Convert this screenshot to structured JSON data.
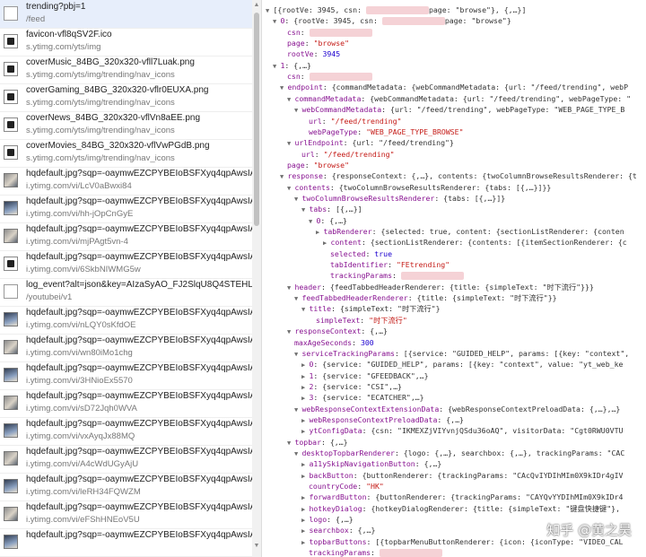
{
  "requests": [
    {
      "name": "trending?pbj=1",
      "path": "/feed",
      "icon": "doc",
      "selected": true
    },
    {
      "name": "favicon-vfl8qSV2F.ico",
      "path": "s.ytimg.com/yts/img",
      "icon": "img"
    },
    {
      "name": "coverMusic_84BG_320x320-vfll7Luak.png",
      "path": "s.ytimg.com/yts/img/trending/nav_icons",
      "icon": "img"
    },
    {
      "name": "coverGaming_84BG_320x320-vflr0EUXA.png",
      "path": "s.ytimg.com/yts/img/trending/nav_icons",
      "icon": "img"
    },
    {
      "name": "coverNews_84BG_320x320-vflVn8aEE.png",
      "path": "s.ytimg.com/yts/img/trending/nav_icons",
      "icon": "img"
    },
    {
      "name": "coverMovies_84BG_320x320-vflVwPGdB.png",
      "path": "s.ytimg.com/yts/img/trending/nav_icons",
      "icon": "img"
    },
    {
      "name": "hqdefault.jpg?sqp=-oaymwEZCPYBEIoBSFXyq4qpAwsIARUAAI",
      "path": "i.ytimg.com/vi/LcV0aBwxi84",
      "icon": "photo"
    },
    {
      "name": "hqdefault.jpg?sqp=-oaymwEZCPYBEIoBSFXyq4qpAwsIARUAAI",
      "path": "i.ytimg.com/vi/hh-jOpCnGyE",
      "icon": "photo2"
    },
    {
      "name": "hqdefault.jpg?sqp=-oaymwEZCPYBEIoBSFXyq4qpAwsIARUAAI",
      "path": "i.ytimg.com/vi/mjPAgt5vn-4",
      "icon": "photo"
    },
    {
      "name": "hqdefault.jpg?sqp=-oaymwEZCPYBEIoBSFXyq4qpAwsIARUAAI",
      "path": "i.ytimg.com/vi/6SkbNIWMG5w",
      "icon": "img"
    },
    {
      "name": "log_event?alt=json&key=AIzaSyAO_FJ2SlqU8Q4STEHLGCilw_Y",
      "path": "/youtubei/v1",
      "icon": "doc"
    },
    {
      "name": "hqdefault.jpg?sqp=-oaymwEZCPYBEIoBSFXyq4qpAwsIARUAAI",
      "path": "i.ytimg.com/vi/nLQY0sKfdOE",
      "icon": "photo2"
    },
    {
      "name": "hqdefault.jpg?sqp=-oaymwEZCPYBEIoBSFXyq4qpAwsIARUAAI",
      "path": "i.ytimg.com/vi/wn80iMo1chg",
      "icon": "photo"
    },
    {
      "name": "hqdefault.jpg?sqp=-oaymwEZCPYBEIoBSFXyq4qpAwsIARUAAI",
      "path": "i.ytimg.com/vi/3HNioEx5570",
      "icon": "photo2"
    },
    {
      "name": "hqdefault.jpg?sqp=-oaymwEZCPYBEIoBSFXyq4qpAwsIARUAAI",
      "path": "i.ytimg.com/vi/sD72Jqh0WVA",
      "icon": "photo"
    },
    {
      "name": "hqdefault.jpg?sqp=-oaymwEZCPYBEIoBSFXyq4qpAwsIARUAAI",
      "path": "i.ytimg.com/vi/vxAyqJx88MQ",
      "icon": "photo2"
    },
    {
      "name": "hqdefault.jpg?sqp=-oaymwEZCPYBEIoBSFXyq4qpAwsIARUAAI",
      "path": "i.ytimg.com/vi/A4cWdUGyAjU",
      "icon": "photo"
    },
    {
      "name": "hqdefault.jpg?sqp=-oaymwEZCPYBEIoBSFXyq4qpAwsIARUAAI",
      "path": "i.ytimg.com/vi/leRH34FQWZM",
      "icon": "photo2"
    },
    {
      "name": "hqdefault.jpg?sqp=-oaymwEZCPYBEIoBSFXyq4qpAwsIARUAAI",
      "path": "i.ytimg.com/vi/eFShHNEoV5U",
      "icon": "photo"
    },
    {
      "name": "hqdefault.jpg?sqp=-oaymwEZCPYBEIoBSFXyq4qpAwsIARUAAI",
      "path": "",
      "icon": "photo2"
    }
  ],
  "preview": [
    {
      "ind": 0,
      "ar": "d",
      "segs": [
        [
          "v",
          "[{rootVe: 3945, csn: "
        ],
        [
          "r",
          ""
        ],
        [
          "v",
          "page: \"browse\"}, {,…}]"
        ]
      ]
    },
    {
      "ind": 1,
      "ar": "d",
      "segs": [
        [
          "k",
          "0"
        ],
        [
          "v",
          ": {rootVe: 3945, csn: "
        ],
        [
          "r",
          ""
        ],
        [
          "v",
          "page: \"browse\"}"
        ]
      ]
    },
    {
      "ind": 3,
      "segs": [
        [
          "k",
          "csn"
        ],
        [
          "v",
          ": "
        ],
        [
          "r",
          ""
        ]
      ]
    },
    {
      "ind": 3,
      "segs": [
        [
          "k",
          "page"
        ],
        [
          "v",
          ": "
        ],
        [
          "s",
          "\"browse\""
        ]
      ]
    },
    {
      "ind": 3,
      "segs": [
        [
          "k",
          "rootVe"
        ],
        [
          "v",
          ": "
        ],
        [
          "n",
          "3945"
        ]
      ]
    },
    {
      "ind": 1,
      "ar": "d",
      "segs": [
        [
          "k",
          "1"
        ],
        [
          "v",
          ": {,…}"
        ]
      ]
    },
    {
      "ind": 3,
      "segs": [
        [
          "k",
          "csn"
        ],
        [
          "v",
          ": "
        ],
        [
          "r",
          ""
        ]
      ]
    },
    {
      "ind": 2,
      "ar": "d",
      "segs": [
        [
          "k",
          "endpoint"
        ],
        [
          "v",
          ": {commandMetadata: {webCommandMetadata: {url: \"/feed/trending\", webP"
        ]
      ]
    },
    {
      "ind": 3,
      "ar": "d",
      "segs": [
        [
          "k",
          "commandMetadata"
        ],
        [
          "v",
          ": {webCommandMetadata: {url: \"/feed/trending\", webPageType: \""
        ]
      ]
    },
    {
      "ind": 4,
      "ar": "d",
      "segs": [
        [
          "k",
          "webCommandMetadata"
        ],
        [
          "v",
          ": {url: \"/feed/trending\", webPageType: \"WEB_PAGE_TYPE_B"
        ]
      ]
    },
    {
      "ind": 6,
      "segs": [
        [
          "k",
          "url"
        ],
        [
          "v",
          ": "
        ],
        [
          "s",
          "\"/feed/trending\""
        ]
      ]
    },
    {
      "ind": 6,
      "segs": [
        [
          "k",
          "webPageType"
        ],
        [
          "v",
          ": "
        ],
        [
          "s",
          "\"WEB_PAGE_TYPE_BROWSE\""
        ]
      ]
    },
    {
      "ind": 3,
      "ar": "d",
      "segs": [
        [
          "k",
          "urlEndpoint"
        ],
        [
          "v",
          ": {url: \"/feed/trending\"}"
        ]
      ]
    },
    {
      "ind": 5,
      "segs": [
        [
          "k",
          "url"
        ],
        [
          "v",
          ": "
        ],
        [
          "s",
          "\"/feed/trending\""
        ]
      ]
    },
    {
      "ind": 3,
      "segs": [
        [
          "k",
          "page"
        ],
        [
          "v",
          ": "
        ],
        [
          "s",
          "\"browse\""
        ]
      ]
    },
    {
      "ind": 2,
      "ar": "d",
      "segs": [
        [
          "k",
          "response"
        ],
        [
          "v",
          ": {responseContext: {,…}, contents: {twoColumnBrowseResultsRenderer: {t"
        ]
      ]
    },
    {
      "ind": 3,
      "ar": "d",
      "segs": [
        [
          "k",
          "contents"
        ],
        [
          "v",
          ": {twoColumnBrowseResultsRenderer: {tabs: [{,…}]}}"
        ]
      ]
    },
    {
      "ind": 4,
      "ar": "d",
      "segs": [
        [
          "k",
          "twoColumnBrowseResultsRenderer"
        ],
        [
          "v",
          ": {tabs: [{,…}]}"
        ]
      ]
    },
    {
      "ind": 5,
      "ar": "d",
      "segs": [
        [
          "k",
          "tabs"
        ],
        [
          "v",
          ": [{,…}]"
        ]
      ]
    },
    {
      "ind": 6,
      "ar": "d",
      "segs": [
        [
          "k",
          "0"
        ],
        [
          "v",
          ": {,…}"
        ]
      ]
    },
    {
      "ind": 7,
      "ar": "r",
      "segs": [
        [
          "k",
          "tabRenderer"
        ],
        [
          "v",
          ": {selected: true, content: {sectionListRenderer: {conten"
        ]
      ]
    },
    {
      "ind": 8,
      "ar": "r",
      "segs": [
        [
          "k",
          "content"
        ],
        [
          "v",
          ": {sectionListRenderer: {contents: [{itemSectionRenderer: {c"
        ]
      ]
    },
    {
      "ind": 9,
      "segs": [
        [
          "k",
          "selected"
        ],
        [
          "v",
          ": "
        ],
        [
          "n",
          "true"
        ]
      ]
    },
    {
      "ind": 9,
      "segs": [
        [
          "k",
          "tabIdentifier"
        ],
        [
          "v",
          ": "
        ],
        [
          "s",
          "\"FEtrending\""
        ]
      ]
    },
    {
      "ind": 9,
      "segs": [
        [
          "k",
          "trackingParams"
        ],
        [
          "v",
          ": "
        ],
        [
          "r",
          ""
        ]
      ]
    },
    {
      "ind": 3,
      "ar": "d",
      "segs": [
        [
          "k",
          "header"
        ],
        [
          "v",
          ": {feedTabbedHeaderRenderer: {title: {simpleText: \"时下流行\"}}}"
        ]
      ]
    },
    {
      "ind": 4,
      "ar": "d",
      "segs": [
        [
          "k",
          "feedTabbedHeaderRenderer"
        ],
        [
          "v",
          ": {title: {simpleText: \"时下流行\"}}"
        ]
      ]
    },
    {
      "ind": 5,
      "ar": "d",
      "segs": [
        [
          "k",
          "title"
        ],
        [
          "v",
          ": {simpleText: \"时下流行\"}"
        ]
      ]
    },
    {
      "ind": 7,
      "segs": [
        [
          "k",
          "simpleText"
        ],
        [
          "v",
          ": "
        ],
        [
          "s",
          "\"时下流行\""
        ]
      ]
    },
    {
      "ind": 3,
      "ar": "d",
      "segs": [
        [
          "k",
          "responseContext"
        ],
        [
          "v",
          ": {,…}"
        ]
      ]
    },
    {
      "ind": 4,
      "segs": [
        [
          "k",
          "maxAgeSeconds"
        ],
        [
          "v",
          ": "
        ],
        [
          "n",
          "300"
        ]
      ]
    },
    {
      "ind": 4,
      "ar": "d",
      "segs": [
        [
          "k",
          "serviceTrackingParams"
        ],
        [
          "v",
          ": [{service: \"GUIDED_HELP\", params: [{key: \"context\","
        ]
      ]
    },
    {
      "ind": 5,
      "ar": "r",
      "segs": [
        [
          "k",
          "0"
        ],
        [
          "v",
          ": {service: \"GUIDED_HELP\", params: [{key: \"context\", value: \"yt_web_ke"
        ]
      ]
    },
    {
      "ind": 5,
      "ar": "r",
      "segs": [
        [
          "k",
          "1"
        ],
        [
          "v",
          ": {service: \"GFEEDBACK\",…}"
        ]
      ]
    },
    {
      "ind": 5,
      "ar": "r",
      "segs": [
        [
          "k",
          "2"
        ],
        [
          "v",
          ": {service: \"CSI\",…}"
        ]
      ]
    },
    {
      "ind": 5,
      "ar": "r",
      "segs": [
        [
          "k",
          "3"
        ],
        [
          "v",
          ": {service: \"ECATCHER\",…}"
        ]
      ]
    },
    {
      "ind": 4,
      "ar": "d",
      "segs": [
        [
          "k",
          "webResponseContextExtensionData"
        ],
        [
          "v",
          ": {webResponseContextPreloadData: {,…},…}"
        ]
      ]
    },
    {
      "ind": 5,
      "ar": "r",
      "segs": [
        [
          "k",
          "webResponseContextPreloadData"
        ],
        [
          "v",
          ": {,…}"
        ]
      ]
    },
    {
      "ind": 5,
      "ar": "r",
      "segs": [
        [
          "k",
          "ytConfigData"
        ],
        [
          "v",
          ": {csn: \"IKMEXZjVIYvnjQSdu36oAQ\", visitorData: \"Cgt0RWU0VTU"
        ]
      ]
    },
    {
      "ind": 3,
      "ar": "d",
      "segs": [
        [
          "k",
          "topbar"
        ],
        [
          "v",
          ": {,…}"
        ]
      ]
    },
    {
      "ind": 4,
      "ar": "d",
      "segs": [
        [
          "k",
          "desktopTopbarRenderer"
        ],
        [
          "v",
          ": {logo: {,…}, searchbox: {,…}, trackingParams: \"CAC"
        ]
      ]
    },
    {
      "ind": 5,
      "ar": "r",
      "segs": [
        [
          "k",
          "a11ySkipNavigationButton"
        ],
        [
          "v",
          ": {,…}"
        ]
      ]
    },
    {
      "ind": 5,
      "ar": "r",
      "segs": [
        [
          "k",
          "backButton"
        ],
        [
          "v",
          ": {buttonRenderer: {trackingParams: \"CAcQvIYDIhMIm0X9kIDr4gIV"
        ]
      ]
    },
    {
      "ind": 6,
      "segs": [
        [
          "k",
          "countryCode"
        ],
        [
          "v",
          ": "
        ],
        [
          "s",
          "\"HK\""
        ]
      ]
    },
    {
      "ind": 5,
      "ar": "r",
      "segs": [
        [
          "k",
          "forwardButton"
        ],
        [
          "v",
          ": {buttonRenderer: {trackingParams: \"CAYQvYYDIhMIm0X9kIDr4"
        ]
      ]
    },
    {
      "ind": 5,
      "ar": "r",
      "segs": [
        [
          "k",
          "hotkeyDialog"
        ],
        [
          "v",
          ": {hotkeyDialogRenderer: {title: {simpleText: \"键盘快捷键\"},"
        ]
      ]
    },
    {
      "ind": 5,
      "ar": "r",
      "segs": [
        [
          "k",
          "logo"
        ],
        [
          "v",
          ": {,…}"
        ]
      ]
    },
    {
      "ind": 5,
      "ar": "r",
      "segs": [
        [
          "k",
          "searchbox"
        ],
        [
          "v",
          ": {,…}"
        ]
      ]
    },
    {
      "ind": 5,
      "ar": "r",
      "segs": [
        [
          "k",
          "topbarButtons"
        ],
        [
          "v",
          ": [{topbarMenuButtonRenderer: {icon: {iconType: \"VIDEO_CAL"
        ]
      ]
    },
    {
      "ind": 6,
      "segs": [
        [
          "k",
          "trackingParams"
        ],
        [
          "v",
          ": "
        ],
        [
          "r",
          ""
        ]
      ]
    }
  ],
  "watermark": "知乎 @黄之昊",
  "colors": {
    "selected_row": "#e7eefb",
    "json_key": "#881391",
    "json_string": "#c41a16",
    "json_number": "#1c00cf"
  }
}
